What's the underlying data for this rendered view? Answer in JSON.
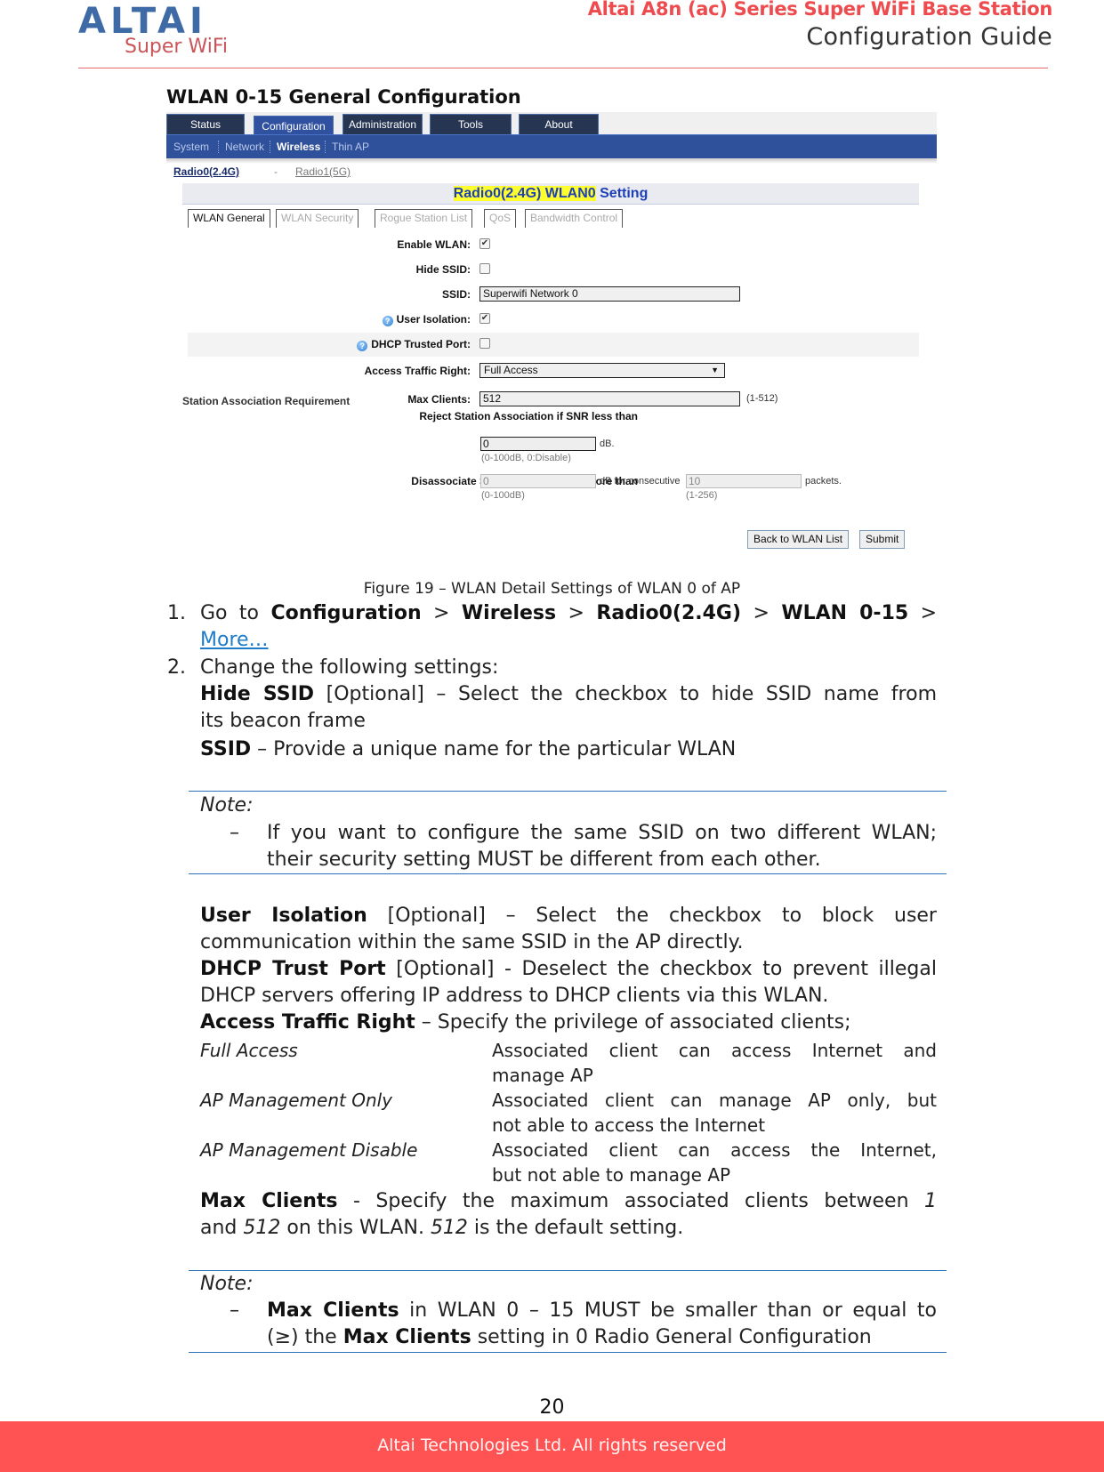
{
  "header": {
    "logo_main": "ALTAI",
    "logo_sub": "Super WiFi",
    "doc_title": "Altai A8n (ac) Series Super WiFi Base Station",
    "doc_subtitle": "Configuration Guide"
  },
  "section_title": "WLAN 0-15 General Configuration",
  "screenshot": {
    "top_tabs": [
      {
        "label": "Status",
        "active": false
      },
      {
        "label": "Configuration",
        "active": true
      },
      {
        "label": "Administration",
        "active": false
      },
      {
        "label": "Tools",
        "active": false
      },
      {
        "label": "About",
        "active": false
      }
    ],
    "sub_nav": [
      {
        "label": "System",
        "active": false
      },
      {
        "label": "Network",
        "active": false
      },
      {
        "label": "Wireless",
        "active": true
      },
      {
        "label": "Thin AP",
        "active": false
      }
    ],
    "radio_links": {
      "radio0": "Radio0(2.4G)",
      "separator": "-",
      "radio1": "Radio1(5G)"
    },
    "setting_title": {
      "highlighted": "Radio0(2.4G) WLAN0",
      "rest": " Setting"
    },
    "wlan_tabs": [
      "WLAN General",
      "WLAN Security",
      "Rogue Station List",
      "QoS",
      "Bandwidth Control"
    ],
    "fields": {
      "enable_wlan": {
        "label": "Enable WLAN:",
        "checked": true
      },
      "hide_ssid": {
        "label": "Hide SSID:",
        "checked": false
      },
      "ssid": {
        "label": "SSID:",
        "value": "Superwifi Network 0"
      },
      "user_isolation": {
        "label": "User Isolation:",
        "checked": true
      },
      "dhcp_trusted_port": {
        "label": "DHCP Trusted Port:",
        "checked": false
      },
      "access_traffic_right": {
        "label": "Access Traffic Right:",
        "value": "Full Access"
      },
      "max_clients": {
        "label": "Max Clients:",
        "value": "512",
        "hint": "(1-512)"
      }
    },
    "station_assoc": {
      "title": "Station Association Requirement",
      "reject_label": "Reject Station Association if SNR less than",
      "reject_value": "0",
      "reject_unit": "dB.",
      "reject_hint": "(0-100dB, 0:Disable)",
      "disassoc_label": "Disassociate Station if SNR drops more than",
      "disassoc_value": "0",
      "disassoc_unit": "dB for consecutive",
      "disassoc_hint": "(0-100dB)",
      "packets_value": "10",
      "packets_unit": "packets.",
      "packets_hint": "(1-256)"
    },
    "buttons": {
      "back": "Back to WLAN List",
      "submit": "Submit"
    },
    "check_glyph": "✔",
    "help_glyph": "?",
    "dropdown_arrow": "▼"
  },
  "caption": "Figure 19 – WLAN Detail Settings of WLAN 0 of AP",
  "steps": {
    "step1_num": "1.",
    "step1_goto": "Go to",
    "step1_path": [
      "Configuration",
      "Wireless",
      "Radio0(2.4G)",
      "WLAN 0-15"
    ],
    "step1_sep": ">",
    "step1_link": "More…",
    "step2_num": "2.",
    "step2_intro": "Change the following settings:",
    "hide_ssid_term": "Hide SSID",
    "hide_ssid_desc1": " [Optional] – Select the checkbox to hide SSID name from",
    "hide_ssid_desc2": "its beacon frame",
    "ssid_term": "SSID",
    "ssid_desc": " – Provide a unique name for the particular WLAN"
  },
  "note1": {
    "label": "Note:",
    "dash": "–",
    "line1": "If you want to configure the same SSID on two different WLAN;",
    "line2": "their security setting MUST be different from each other."
  },
  "descriptions": {
    "user_isolation_term": "User Isolation",
    "user_isolation_desc1": " [Optional] – Select the checkbox to block user",
    "user_isolation_desc2": "communication within the same SSID in the AP directly.",
    "dhcp_term": "DHCP Trust Port",
    "dhcp_desc1": " [Optional] - Deselect the checkbox to prevent illegal",
    "dhcp_desc2": "DHCP servers offering IP address to DHCP clients via this WLAN.",
    "atr_term": "Access Traffic Right",
    "atr_desc": " – Specify the privilege of associated clients;",
    "atr_options": [
      {
        "term": "Full Access",
        "desc1": "Associated client can access Internet and",
        "desc2": "manage AP"
      },
      {
        "term": "AP Management Only",
        "desc1": "Associated client can manage AP only, but",
        "desc2": "not able to access the Internet"
      },
      {
        "term": "AP Management Disable",
        "desc1": "Associated client can access the Internet,",
        "desc2": "but not able to manage AP"
      }
    ],
    "max_clients_term": "Max Clients",
    "max_clients_desc1a": " - Specify the maximum associated clients between ",
    "max_clients_min": "1",
    "max_clients_desc2a": "and ",
    "max_clients_max": "512",
    "max_clients_desc2b": " on this WLAN. ",
    "max_clients_default": "512",
    "max_clients_desc2c": " is the default setting."
  },
  "note2": {
    "label": "Note:",
    "dash": "–",
    "term": "Max Clients",
    "line1_rest": " in WLAN 0 – 15 MUST be smaller than or equal to",
    "line2_a": "(≥) the ",
    "line2_term": "Max Clients",
    "line2_rest": " setting in 0 Radio General Configuration"
  },
  "footer": {
    "page_number": "20",
    "copyright": "Altai Technologies Ltd. All rights reserved"
  }
}
